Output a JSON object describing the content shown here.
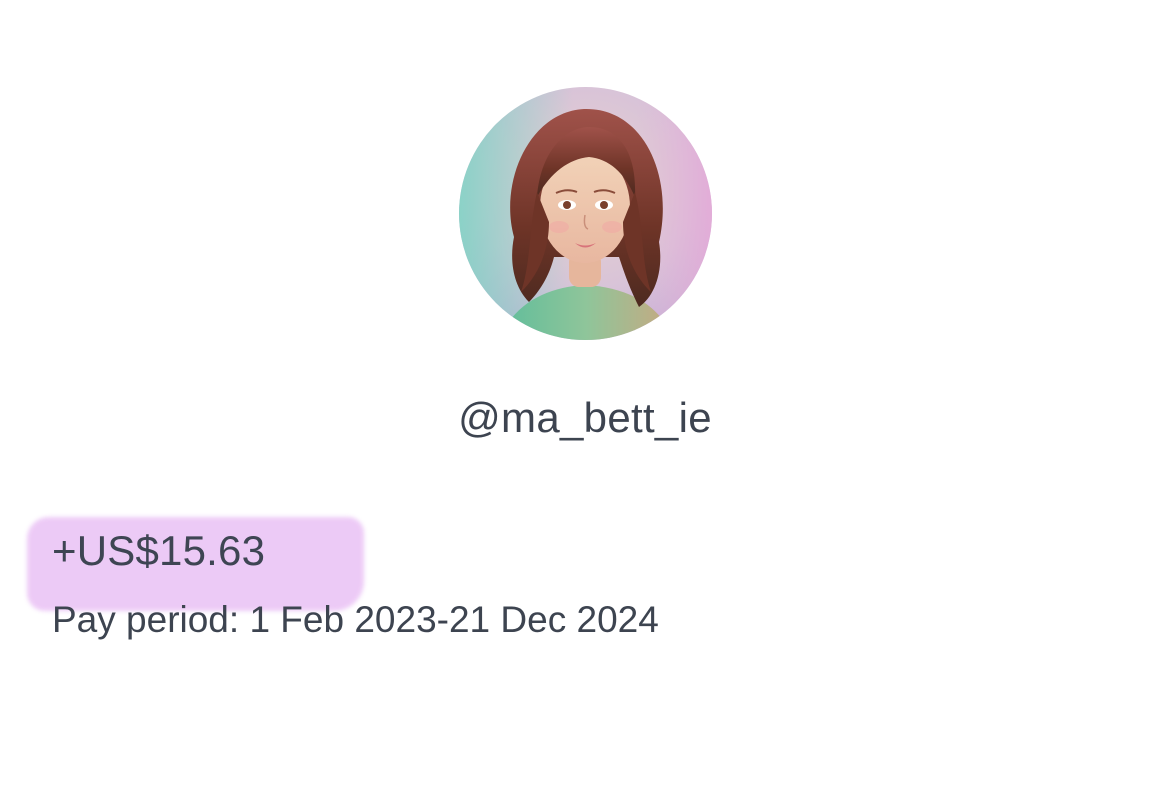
{
  "profile": {
    "avatar_icon": "profile-avatar-portrait",
    "handle": "@ma_bett_ie"
  },
  "earnings": {
    "amount": "+US$15.63",
    "pay_period": "Pay period: 1 Feb 2023-21 Dec 2024",
    "highlight_color": "#ecc8f6"
  }
}
